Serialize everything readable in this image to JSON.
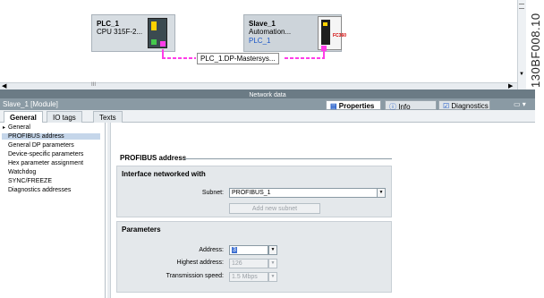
{
  "network": {
    "plc": {
      "name": "PLC_1",
      "type": "CPU 315F-2..."
    },
    "slave": {
      "name": "Slave_1",
      "type": "Automation...",
      "link": "PLC_1",
      "brand": "FC360"
    },
    "subnet_label": "PLC_1.DP-Mastersys...",
    "scroll_marker": "III",
    "network_data_label": "Network data"
  },
  "module_bar": {
    "title": "Slave_1 [Module]",
    "tabs": [
      {
        "label": "Properties",
        "icon": "properties-icon",
        "active": true
      },
      {
        "label": "Info",
        "icon": "info-icon"
      },
      {
        "label": "Diagnostics",
        "icon": "diagnostics-icon"
      }
    ]
  },
  "sub_tabs": [
    "General",
    "IO tags",
    "Texts"
  ],
  "nav": {
    "items": [
      "General",
      "PROFIBUS address",
      "General DP parameters",
      "Device-specific parameters",
      "Hex parameter assignment",
      "Watchdog",
      "SYNC/FREEZE",
      "Diagnostics addresses"
    ],
    "selected": "PROFIBUS address"
  },
  "content": {
    "section_title": "PROFIBUS address",
    "interface_panel": {
      "title": "Interface networked with",
      "subnet_label": "Subnet:",
      "subnet_value": "PROFIBUS_1",
      "add_button": "Add new subnet"
    },
    "parameters_panel": {
      "title": "Parameters",
      "address_label": "Address:",
      "address_value": "3",
      "highest_label": "Highest address:",
      "highest_value": "126",
      "speed_label": "Transmission speed:",
      "speed_value": "1.5 Mbps"
    }
  },
  "side_code": "130BF008.10",
  "colors": {
    "accent_pink": "#ff3de8",
    "header_bar": "#8a9aa4",
    "selected_nav": "#c5d6ea"
  }
}
